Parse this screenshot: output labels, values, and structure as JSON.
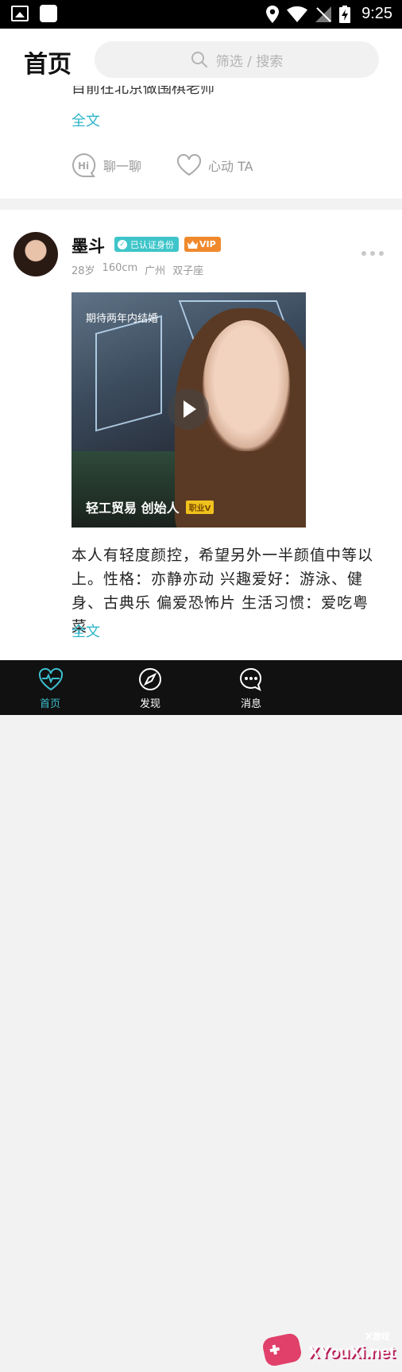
{
  "status_bar": {
    "time": "9:25"
  },
  "header": {
    "title": "首页",
    "search_placeholder": "筛选 / 搜索"
  },
  "post_prev": {
    "text_cut": "目前在北京做围棋老师",
    "full_text_link": "全文",
    "chat_label": "聊一聊",
    "like_label": "心动 TA"
  },
  "post": {
    "name": "墨斗",
    "verified_badge": "已认证身份",
    "vip_badge": "VIP",
    "meta": [
      "28岁",
      "160cm",
      "广州",
      "双子座"
    ],
    "video": {
      "top_caption": "期待两年内结婚",
      "bottom_caption": "轻工贸易 创始人",
      "tag": "职业V"
    },
    "bio": "本人有轻度颜控，希望另外一半颜值中等以上。性格：亦静亦动 兴趣爱好：游泳、健身、古典乐 偏爱恐怖片 生活习惯：爱吃粤菜",
    "full_text_link": "全文"
  },
  "tabbar": [
    {
      "label": "首页",
      "icon": "heart-pulse-icon",
      "active": true
    },
    {
      "label": "发现",
      "icon": "discover-icon",
      "active": false
    },
    {
      "label": "消息",
      "icon": "message-icon",
      "active": false
    }
  ],
  "watermark": {
    "main": "XYouXi.net",
    "sub": "X游戏"
  },
  "colors": {
    "accent": "#30b6c9",
    "vip": "#f0892c",
    "verify": "#3ec5c9"
  }
}
